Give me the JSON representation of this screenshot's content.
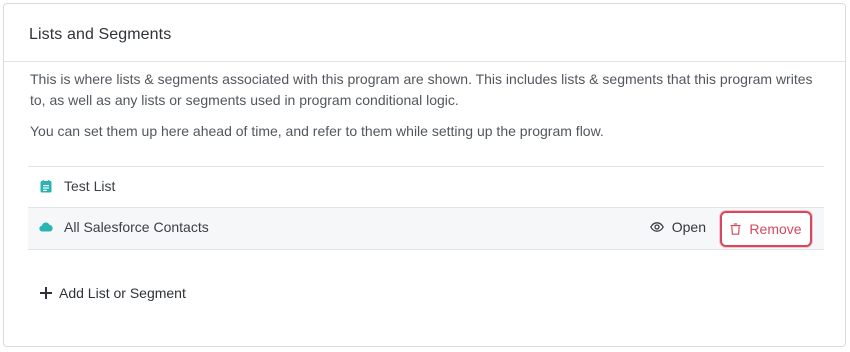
{
  "panel": {
    "title": "Lists and Segments",
    "description_1": "This is where lists & segments associated with this program are shown. This includes lists & segments that this program writes to, as well as any lists or segments used in program conditional logic.",
    "description_2": "You can set them up here ahead of time, and refer to them while setting up the program flow."
  },
  "items": [
    {
      "label": "Test List",
      "icon": "list-icon"
    },
    {
      "label": "All Salesforce Contacts",
      "icon": "cloud-icon"
    }
  ],
  "actions": {
    "open_label": "Open",
    "remove_label": "Remove",
    "add_label": "Add List or Segment"
  },
  "colors": {
    "accent_teal": "#2bb3b3",
    "danger": "#d6485e"
  }
}
